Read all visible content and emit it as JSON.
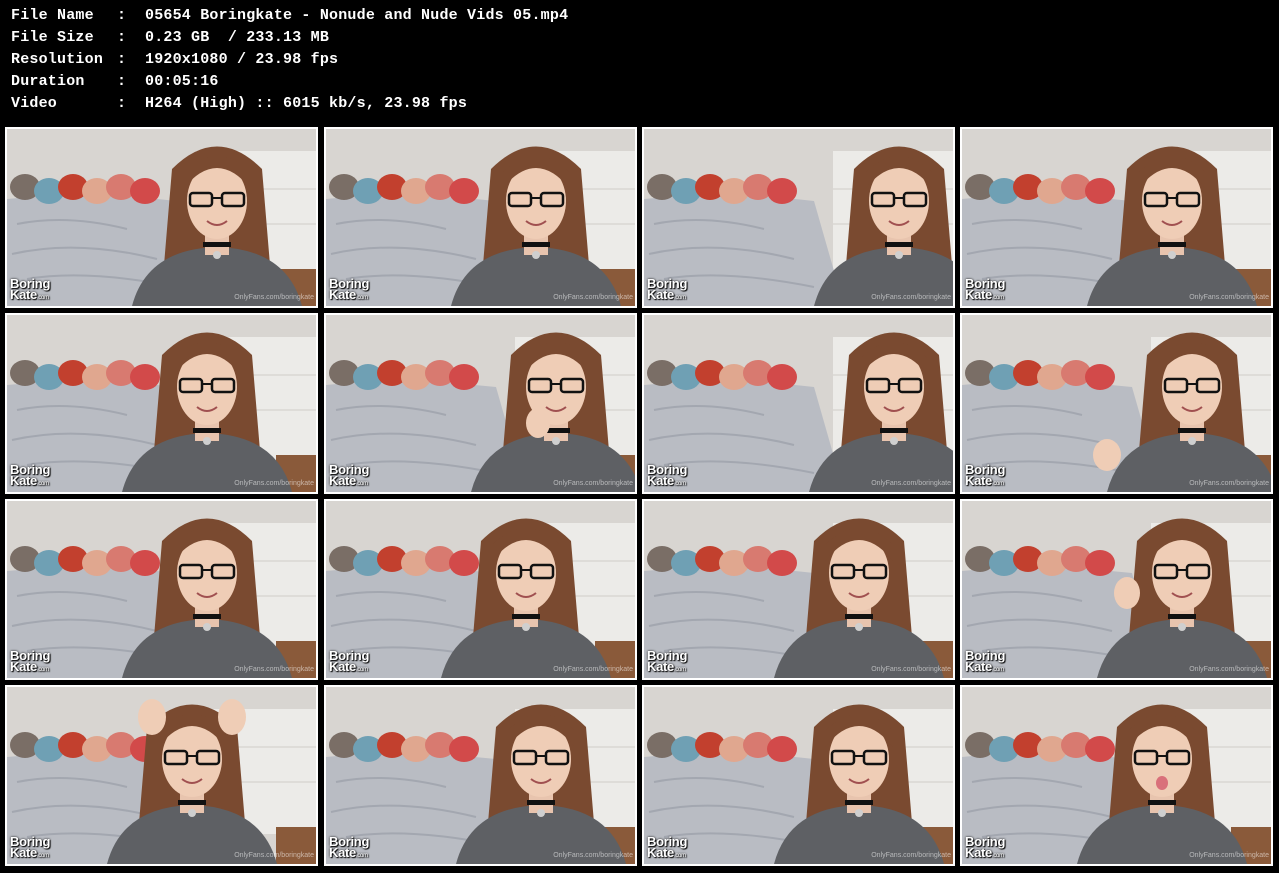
{
  "file_info": [
    {
      "label": "File Name",
      "sep": ":",
      "value": "05654 Boringkate - Nonude and Nude Vids 05.mp4"
    },
    {
      "label": "File Size",
      "sep": ":",
      "value": "0.23 GB  / 233.13 MB"
    },
    {
      "label": "Resolution",
      "sep": ":",
      "value": "1920x1080 / 23.98 fps"
    },
    {
      "label": "Duration",
      "sep": ":",
      "value": "00:05:16"
    },
    {
      "label": "Video",
      "sep": ":",
      "value": "H264 (High) :: 6015 kb/s, 23.98 fps"
    }
  ],
  "watermark": {
    "line1": "Boring",
    "line2": "Kate",
    "suffix": ".com"
  },
  "site_mark": "OnlyFans.com/boringkate",
  "colors": {
    "background": "#000000",
    "text": "#ffffff",
    "thumb_border": "#ffffff",
    "wall": "#d8d5d1",
    "bed": "#b9bcc3",
    "hair": "#7a4a30",
    "shirt": "#5e6064",
    "floor": "#8a5a3a"
  },
  "thumbnails": [
    {
      "id": 1,
      "pose": "smile"
    },
    {
      "id": 2,
      "pose": "smile"
    },
    {
      "id": 3,
      "pose": "talking"
    },
    {
      "id": 4,
      "pose": "smile"
    },
    {
      "id": 5,
      "pose": "smile"
    },
    {
      "id": 6,
      "pose": "hand-chin"
    },
    {
      "id": 7,
      "pose": "tilt"
    },
    {
      "id": 8,
      "pose": "point"
    },
    {
      "id": 9,
      "pose": "smile"
    },
    {
      "id": 10,
      "pose": "smile"
    },
    {
      "id": 11,
      "pose": "smile"
    },
    {
      "id": 12,
      "pose": "hand-hair"
    },
    {
      "id": 13,
      "pose": "hands-head"
    },
    {
      "id": 14,
      "pose": "smile"
    },
    {
      "id": 15,
      "pose": "eyes-closed"
    },
    {
      "id": 16,
      "pose": "tongue"
    }
  ]
}
